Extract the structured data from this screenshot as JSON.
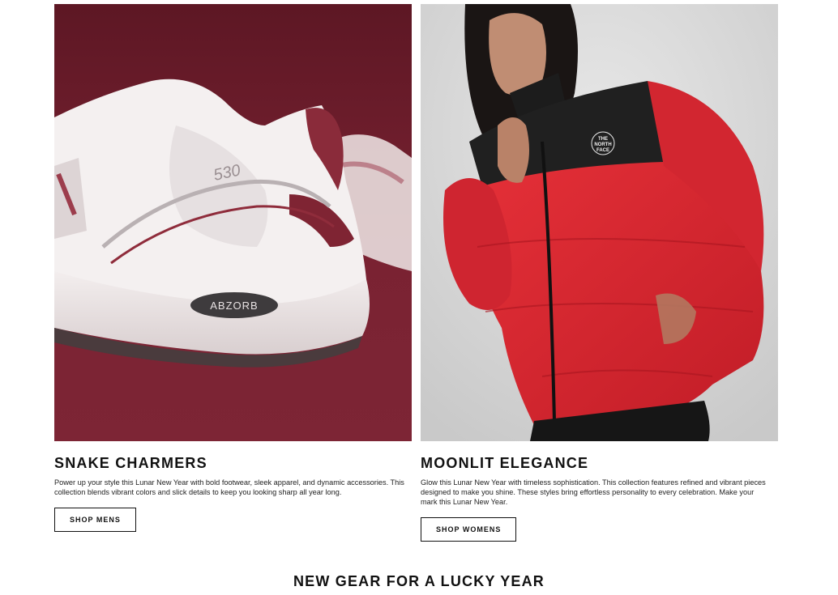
{
  "promos": [
    {
      "title": "SNAKE CHARMERS",
      "description": "Power up your style this Lunar New Year with bold footwear, sleek apparel, and dynamic accessories. This collection blends vibrant colors and slick details to keep you looking sharp all year long.",
      "button_label": "SHOP MENS",
      "image_text": {
        "model": "530",
        "heel": "ABZORB"
      }
    },
    {
      "title": "MOONLIT ELEGANCE",
      "description": "Glow this Lunar New Year with timeless sophistication. This collection features refined and vibrant pieces designed to make you shine. These styles bring effortless personality to every celebration. Make your mark this Lunar New Year.",
      "button_label": "SHOP WOMENS",
      "image_text": {
        "brand_line1": "THE",
        "brand_line2": "NORTH",
        "brand_line3": "FACE"
      }
    }
  ],
  "section_heading": "NEW GEAR FOR A LUCKY YEAR",
  "colors": {
    "shoe_backdrop": "#6e1f2c",
    "jacket_red": "#d8262e",
    "studio_gray": "#d4d4d4"
  }
}
